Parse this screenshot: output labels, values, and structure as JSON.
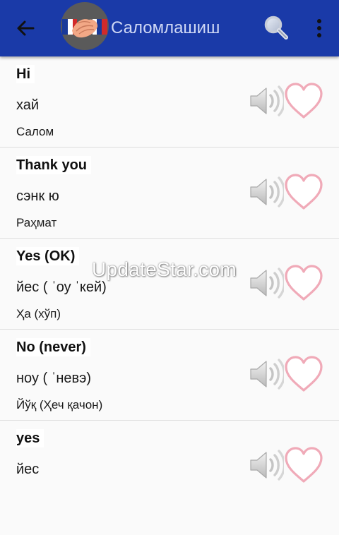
{
  "appbar": {
    "title": "Саломлашиш",
    "back_icon": "arrow-left-icon",
    "search_icon": "search-icon",
    "overflow_icon": "more-vertical-icon",
    "app_icon": "handshake-flags-icon",
    "background_color": "#1a3aa8"
  },
  "phrases": [
    {
      "english": "Hi",
      "transcription": "хай",
      "translation": "Салом"
    },
    {
      "english": "Thank you",
      "transcription": "сэнк ю",
      "translation": "Раҳмат"
    },
    {
      "english": "Yes (OK)",
      "transcription": "йес ( ˈоу ˈкей)",
      "translation": "Ҳа (хўп)"
    },
    {
      "english": "No (never)",
      "transcription": "ноу ( ˈневэ)",
      "translation": "Йўқ (Ҳеч қачон)"
    },
    {
      "english": "yes",
      "transcription": "йес",
      "translation": ""
    }
  ],
  "row_icons": {
    "speaker": "speaker-icon",
    "favorite": "heart-outline-icon",
    "heart_color": "#f0aab8"
  },
  "watermark": "UpdateStar.com"
}
